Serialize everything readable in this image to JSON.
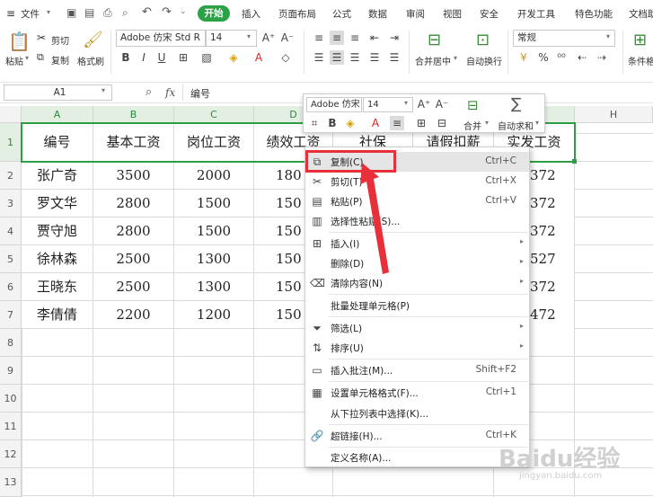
{
  "menubar": {
    "file": "文件",
    "tabs": [
      "开始",
      "插入",
      "页面布局",
      "公式",
      "数据",
      "审阅",
      "视图",
      "安全",
      "开发工具",
      "特色功能",
      "文档助"
    ]
  },
  "ribbon": {
    "paste": "粘贴",
    "cut": "剪切",
    "copy": "复制",
    "format_painter": "格式刷",
    "font_name": "Adobe 仿宋 Std R",
    "font_size": "14",
    "merge_center": "合并居中",
    "wrap_text": "自动换行",
    "number_format": "常规",
    "conditional_format": "条件格"
  },
  "formula_bar": {
    "name_box": "A1",
    "fx": "fx",
    "value": "编号"
  },
  "sheet": {
    "columns": [
      "A",
      "B",
      "C",
      "D",
      "E",
      "F",
      "G",
      "H"
    ],
    "rows": [
      "1",
      "2",
      "3",
      "4",
      "5",
      "6",
      "7",
      "8",
      "9",
      "10",
      "11",
      "12",
      "13"
    ],
    "header": [
      "编号",
      "基本工资",
      "岗位工资",
      "绩效工资",
      "社保",
      "请假扣薪",
      "实发工资"
    ],
    "data": [
      [
        "张广奇",
        "3500",
        "2000",
        "180"
      ],
      [
        "罗文华",
        "2800",
        "1500",
        "150"
      ],
      [
        "贾守旭",
        "2800",
        "1500",
        "150"
      ],
      [
        "徐林森",
        "2500",
        "1300",
        "150"
      ],
      [
        "王晓东",
        "2500",
        "1300",
        "150"
      ],
      [
        "李倩倩",
        "2200",
        "1200",
        "150"
      ]
    ],
    "g_values": [
      "372",
      "372",
      "372",
      "527",
      "372",
      "472"
    ]
  },
  "mini_toolbar": {
    "font_name": "Adobe 仿宋",
    "font_size": "14",
    "merge": "合并",
    "autosum": "自动求和"
  },
  "context_menu": {
    "items": [
      {
        "label": "复制(C)",
        "shortcut": "Ctrl+C",
        "icon": "copy-icon"
      },
      {
        "label": "剪切(T)",
        "shortcut": "Ctrl+X",
        "icon": "scissors-icon"
      },
      {
        "label": "粘贴(P)",
        "shortcut": "Ctrl+V",
        "icon": "paste-icon"
      },
      {
        "label": "选择性粘贴(S)...",
        "shortcut": "",
        "icon": "paste-special-icon"
      },
      {
        "label": "插入(I)",
        "shortcut": "",
        "icon": "insert-icon"
      },
      {
        "label": "删除(D)",
        "shortcut": "",
        "icon": ""
      },
      {
        "label": "清除内容(N)",
        "shortcut": "",
        "icon": "eraser-icon"
      },
      {
        "label": "批量处理单元格(P)",
        "shortcut": "",
        "icon": ""
      },
      {
        "label": "筛选(L)",
        "shortcut": "",
        "icon": "filter-icon"
      },
      {
        "label": "排序(U)",
        "shortcut": "",
        "icon": "sort-icon"
      },
      {
        "label": "插入批注(M)...",
        "shortcut": "Shift+F2",
        "icon": "comment-icon"
      },
      {
        "label": "设置单元格格式(F)...",
        "shortcut": "Ctrl+1",
        "icon": "format-cells-icon"
      },
      {
        "label": "从下拉列表中选择(K)...",
        "shortcut": "",
        "icon": ""
      },
      {
        "label": "超链接(H)...",
        "shortcut": "Ctrl+K",
        "icon": "link-icon"
      },
      {
        "label": "定义名称(A)...",
        "shortcut": "",
        "icon": ""
      }
    ]
  },
  "watermark": {
    "main": "Baidu经验",
    "sub": "jingyan.baidu.com"
  },
  "colors": {
    "accent_green": "#2ba245",
    "selection_border": "#2e9e44",
    "highlight_red": "#e8303a"
  }
}
